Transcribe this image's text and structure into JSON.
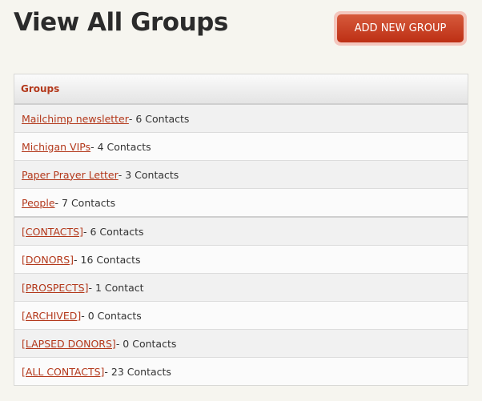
{
  "page": {
    "title": "View All Groups"
  },
  "toolbar": {
    "add_label": "ADD NEW GROUP"
  },
  "table": {
    "header": "Groups",
    "rows": [
      {
        "name": "Mailchimp newsletter ",
        "count": " - 6 Contacts"
      },
      {
        "name": "Michigan VIPs ",
        "count": " - 4 Contacts"
      },
      {
        "name": "Paper Prayer Letter ",
        "count": " - 3 Contacts"
      },
      {
        "name": "People ",
        "count": " - 7 Contacts"
      },
      {
        "name": "[CONTACTS] ",
        "count": " - 6 Contacts"
      },
      {
        "name": "[DONORS] ",
        "count": " - 16 Contacts"
      },
      {
        "name": "[PROSPECTS] ",
        "count": " - 1 Contact"
      },
      {
        "name": "[ARCHIVED] ",
        "count": " - 0 Contacts"
      },
      {
        "name": "[LAPSED DONORS] ",
        "count": " - 0 Contacts"
      },
      {
        "name": "[ALL CONTACTS] ",
        "count": " - 23 Contacts"
      }
    ]
  },
  "colors": {
    "accent": "#b3381b",
    "button": "#c9421f",
    "background": "#f6f5ef"
  }
}
